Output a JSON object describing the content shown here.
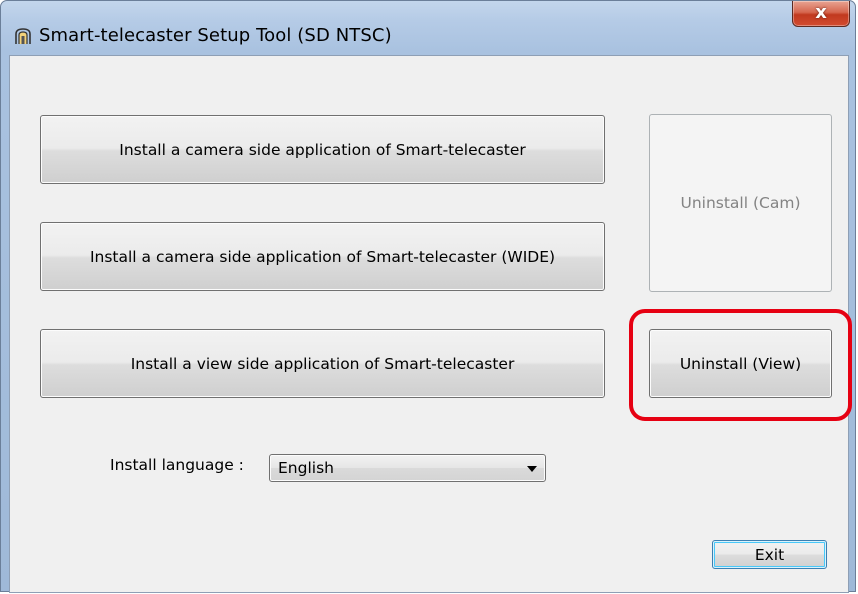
{
  "window": {
    "title": "Smart-telecaster Setup Tool (SD NTSC)",
    "close_label": "x",
    "app_icon": "app-icon"
  },
  "buttons": {
    "install_camera": "Install a camera side application of Smart-telecaster",
    "install_camera_wide": "Install a camera side application of Smart-telecaster (WIDE)",
    "install_view": "Install a view side application of Smart-telecaster",
    "uninstall_cam": "Uninstall (Cam)",
    "uninstall_view": "Uninstall (View)",
    "exit": "Exit"
  },
  "language": {
    "label": "Install language :",
    "selected": "English"
  },
  "colors": {
    "highlight": "#e60012",
    "close_button": "#c1391f"
  }
}
